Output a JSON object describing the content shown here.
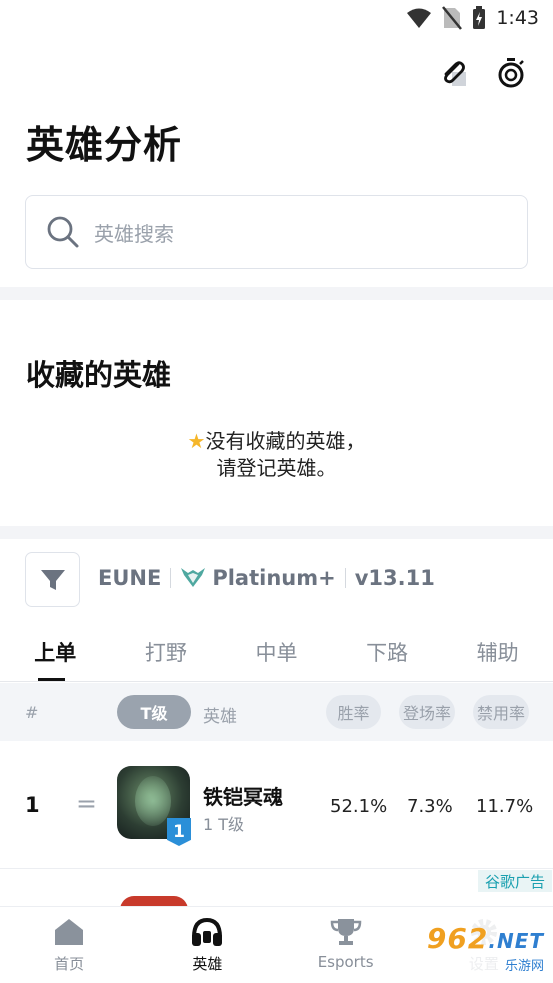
{
  "status_bar": {
    "time": "1:43"
  },
  "header": {
    "title": "英雄分析"
  },
  "search": {
    "placeholder": "英雄搜索"
  },
  "favorites": {
    "title": "收藏的英雄",
    "empty_line1": "没有收藏的英雄，",
    "empty_line2": "请登记英雄。"
  },
  "filters": {
    "region": "EUNE",
    "rank": "Platinum+",
    "version": "v13.11"
  },
  "role_tabs": [
    {
      "label": "上单",
      "active": true
    },
    {
      "label": "打野",
      "active": false
    },
    {
      "label": "中单",
      "active": false
    },
    {
      "label": "下路",
      "active": false
    },
    {
      "label": "辅助",
      "active": false
    }
  ],
  "table_header": {
    "rank": "#",
    "tier": "T级",
    "hero": "英雄",
    "win_rate": "胜率",
    "pick_rate": "登场率",
    "ban_rate": "禁用率"
  },
  "rows": [
    {
      "rank": "1",
      "trend": "=",
      "name": "铁铠冥魂",
      "tier_badge": "1",
      "tier_text": "1 T级",
      "win_rate": "52.1%",
      "pick_rate": "7.3%",
      "ban_rate": "11.7%"
    }
  ],
  "ad": {
    "label": "谷歌广告"
  },
  "bottom_nav": [
    {
      "label": "首页",
      "icon": "home-icon",
      "active": false
    },
    {
      "label": "英雄",
      "icon": "headset-icon",
      "active": true
    },
    {
      "label": "Esports",
      "icon": "trophy-icon",
      "active": false
    },
    {
      "label": "设置",
      "icon": "gear-icon",
      "active": false
    }
  ],
  "watermark": {
    "brand": "962",
    "suffix": ".NET",
    "sub": "乐游网"
  },
  "colors": {
    "accent": "#2b8fd8",
    "tier_pill": "#9aa3ae",
    "ad_text": "#1aa0b0"
  }
}
